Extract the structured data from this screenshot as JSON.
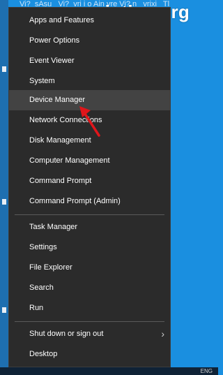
{
  "watermark": "www.wintips.org",
  "header_text": "Vi?_sAsu_ Vi?_vri i o Ain vre Vi? n_ vrixi_ Tl",
  "menu": {
    "group1": [
      {
        "label": "Apps and Features"
      },
      {
        "label": "Power Options"
      },
      {
        "label": "Event Viewer"
      },
      {
        "label": "System"
      },
      {
        "label": "Device Manager",
        "highlighted": true
      },
      {
        "label": "Network Connections"
      },
      {
        "label": "Disk Management"
      },
      {
        "label": "Computer Management"
      },
      {
        "label": "Command Prompt"
      },
      {
        "label": "Command Prompt (Admin)"
      }
    ],
    "group2": [
      {
        "label": "Task Manager"
      },
      {
        "label": "Settings"
      },
      {
        "label": "File Explorer"
      },
      {
        "label": "Search"
      },
      {
        "label": "Run"
      }
    ],
    "group3": [
      {
        "label": "Shut down or sign out",
        "has_submenu": true
      },
      {
        "label": "Desktop"
      }
    ]
  },
  "colors": {
    "menu_bg": "#2b2b2b",
    "highlight_bg": "#434343",
    "annotation_arrow": "#e0161b",
    "desktop_bg": "#1a8fe0"
  },
  "icons": {
    "submenu": "chevron-right-icon",
    "annotation": "red-arrow-annotation"
  },
  "taskbar": {
    "tray_text": "ENG"
  }
}
